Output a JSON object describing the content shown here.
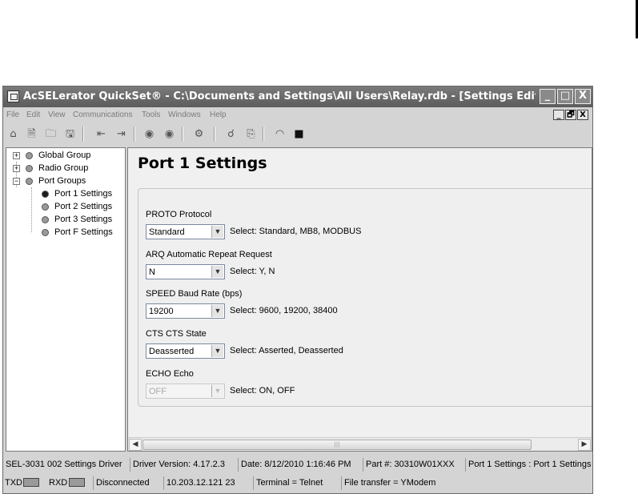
{
  "window": {
    "title": "AcSELerator QuickSet® - C:\\Documents and Settings\\All Users\\Relay.rdb - [Settings Editor - New Settin...",
    "minimize": "_",
    "maximize": "□",
    "close": "X"
  },
  "menu": [
    "File",
    "Edit",
    "View",
    "Communications",
    "Tools",
    "Windows",
    "Help"
  ],
  "mdi": {
    "minimize": "_",
    "restore": "🗗",
    "close": "X"
  },
  "tree": {
    "groups": [
      {
        "label": "Global Group",
        "expander": "+"
      },
      {
        "label": "Radio Group",
        "expander": "+"
      },
      {
        "label": "Port Groups",
        "expander": "−"
      }
    ],
    "children": [
      "Port 1 Settings",
      "Port 2 Settings",
      "Port 3 Settings",
      "Port F Settings"
    ]
  },
  "panel": {
    "title": "Port 1 Settings",
    "settings": [
      {
        "label": "PROTO  Protocol",
        "value": "Standard",
        "hint": "Select: Standard, MB8, MODBUS"
      },
      {
        "label": "ARQ  Automatic Repeat Request",
        "value": "N",
        "hint": "Select: Y, N"
      },
      {
        "label": "SPEED  Baud Rate (bps)",
        "value": "19200",
        "hint": "Select: 9600, 19200, 38400"
      },
      {
        "label": "CTS  CTS State",
        "value": "Deasserted",
        "hint": "Select: Asserted, Deasserted"
      },
      {
        "label": "ECHO  Echo",
        "value": "OFF",
        "hint": "Select: ON, OFF"
      }
    ]
  },
  "status": {
    "driver": "SEL-3031 002 Settings Driver",
    "version": "Driver Version: 4.17.2.3",
    "date": "Date: 8/12/2010 1:16:46 PM",
    "part": "Part #: 30310W01XXX",
    "location": "Port 1 Settings : Port 1 Settings",
    "txd": "TXD",
    "rxd": "RXD",
    "connection": "Disconnected",
    "address": "10.203.12.121  23",
    "terminal": "Terminal = Telnet",
    "transfer": "File transfer = YModem"
  }
}
